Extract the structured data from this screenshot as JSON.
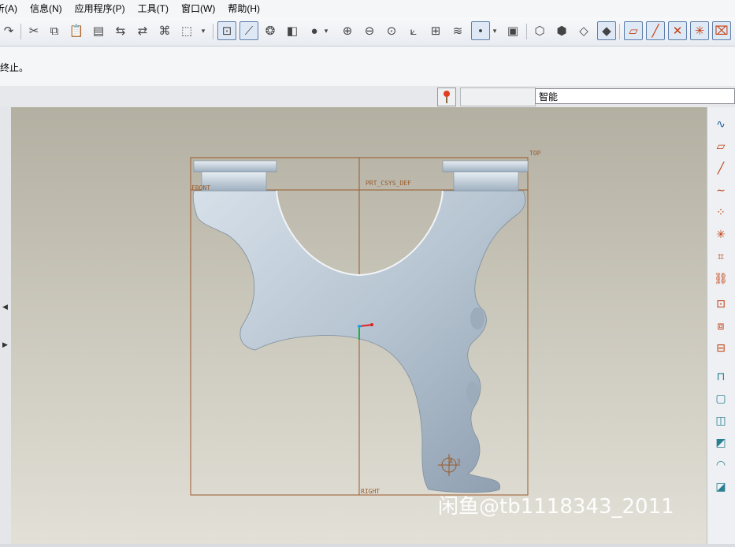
{
  "menu": [
    {
      "label": "析(A)"
    },
    {
      "label": "信息(N)"
    },
    {
      "label": "应用程序(P)"
    },
    {
      "label": "工具(T)"
    },
    {
      "label": "窗口(W)"
    },
    {
      "label": "帮助(H)"
    }
  ],
  "message": "终止。",
  "selection_filter": {
    "value": "智能"
  },
  "datums": {
    "top": "TOP",
    "front": "FRONT",
    "right": "RIGHT",
    "csys": "PRT_CSYS_DEF",
    "axis": "A_3"
  },
  "watermark": "闲鱼@tb1118343_2011",
  "colors": {
    "viewport_top": "#b3b0a2",
    "viewport_bottom": "#e2e0d7",
    "part": "#b5c3d0",
    "datum": "#9a5a2a"
  }
}
